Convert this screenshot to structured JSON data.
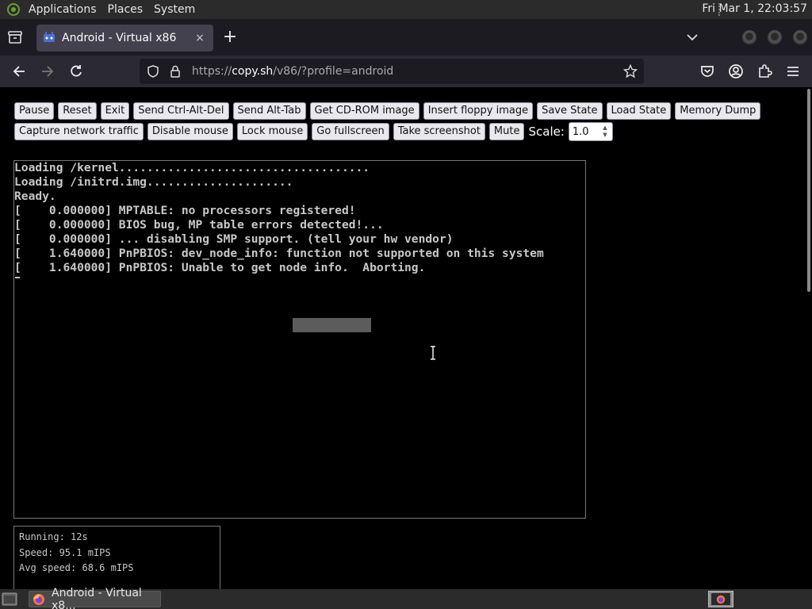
{
  "top_panel": {
    "menus": [
      "Applications",
      "Places",
      "System"
    ],
    "clock": "Fri Mar  1, 22:03:57"
  },
  "browser": {
    "tab": {
      "title": "Android - Virtual x86",
      "close": "×"
    },
    "new_tab": "+",
    "url": {
      "scheme": "https://",
      "host": "copy.sh",
      "path": "/v86/?profile=android"
    }
  },
  "page": {
    "buttons_row1": [
      "Pause",
      "Reset",
      "Exit",
      "Send Ctrl-Alt-Del",
      "Send Alt-Tab",
      "Get CD-ROM image",
      "Insert floppy image",
      "Save State",
      "Load State",
      "Memory Dump"
    ],
    "buttons_row2": [
      "Capture network traffic",
      "Disable mouse",
      "Lock mouse",
      "Go fullscreen",
      "Take screenshot",
      "Mute"
    ],
    "scale_label": "Scale:",
    "scale_value": "1.0",
    "console_lines": [
      "Loading /kernel....................................",
      "Loading /initrd.img.....................",
      "Ready.",
      "[    0.000000] MPTABLE: no processors registered!",
      "[    0.000000] BIOS bug, MP table errors detected!...",
      "[    0.000000] ... disabling SMP support. (tell your hw vendor)",
      "[    1.640000] PnPBIOS: dev_node_info: function not supported on this system",
      "[    1.640000] PnPBIOS: Unable to get node info.  Aborting."
    ],
    "stats": {
      "running": "Running: 12s",
      "speed": "Speed: 95.1 mIPS",
      "avg_speed": "Avg speed: 68.6 mIPS"
    }
  },
  "bottom_panel": {
    "task_title": "Android - Virtual x8..."
  }
}
